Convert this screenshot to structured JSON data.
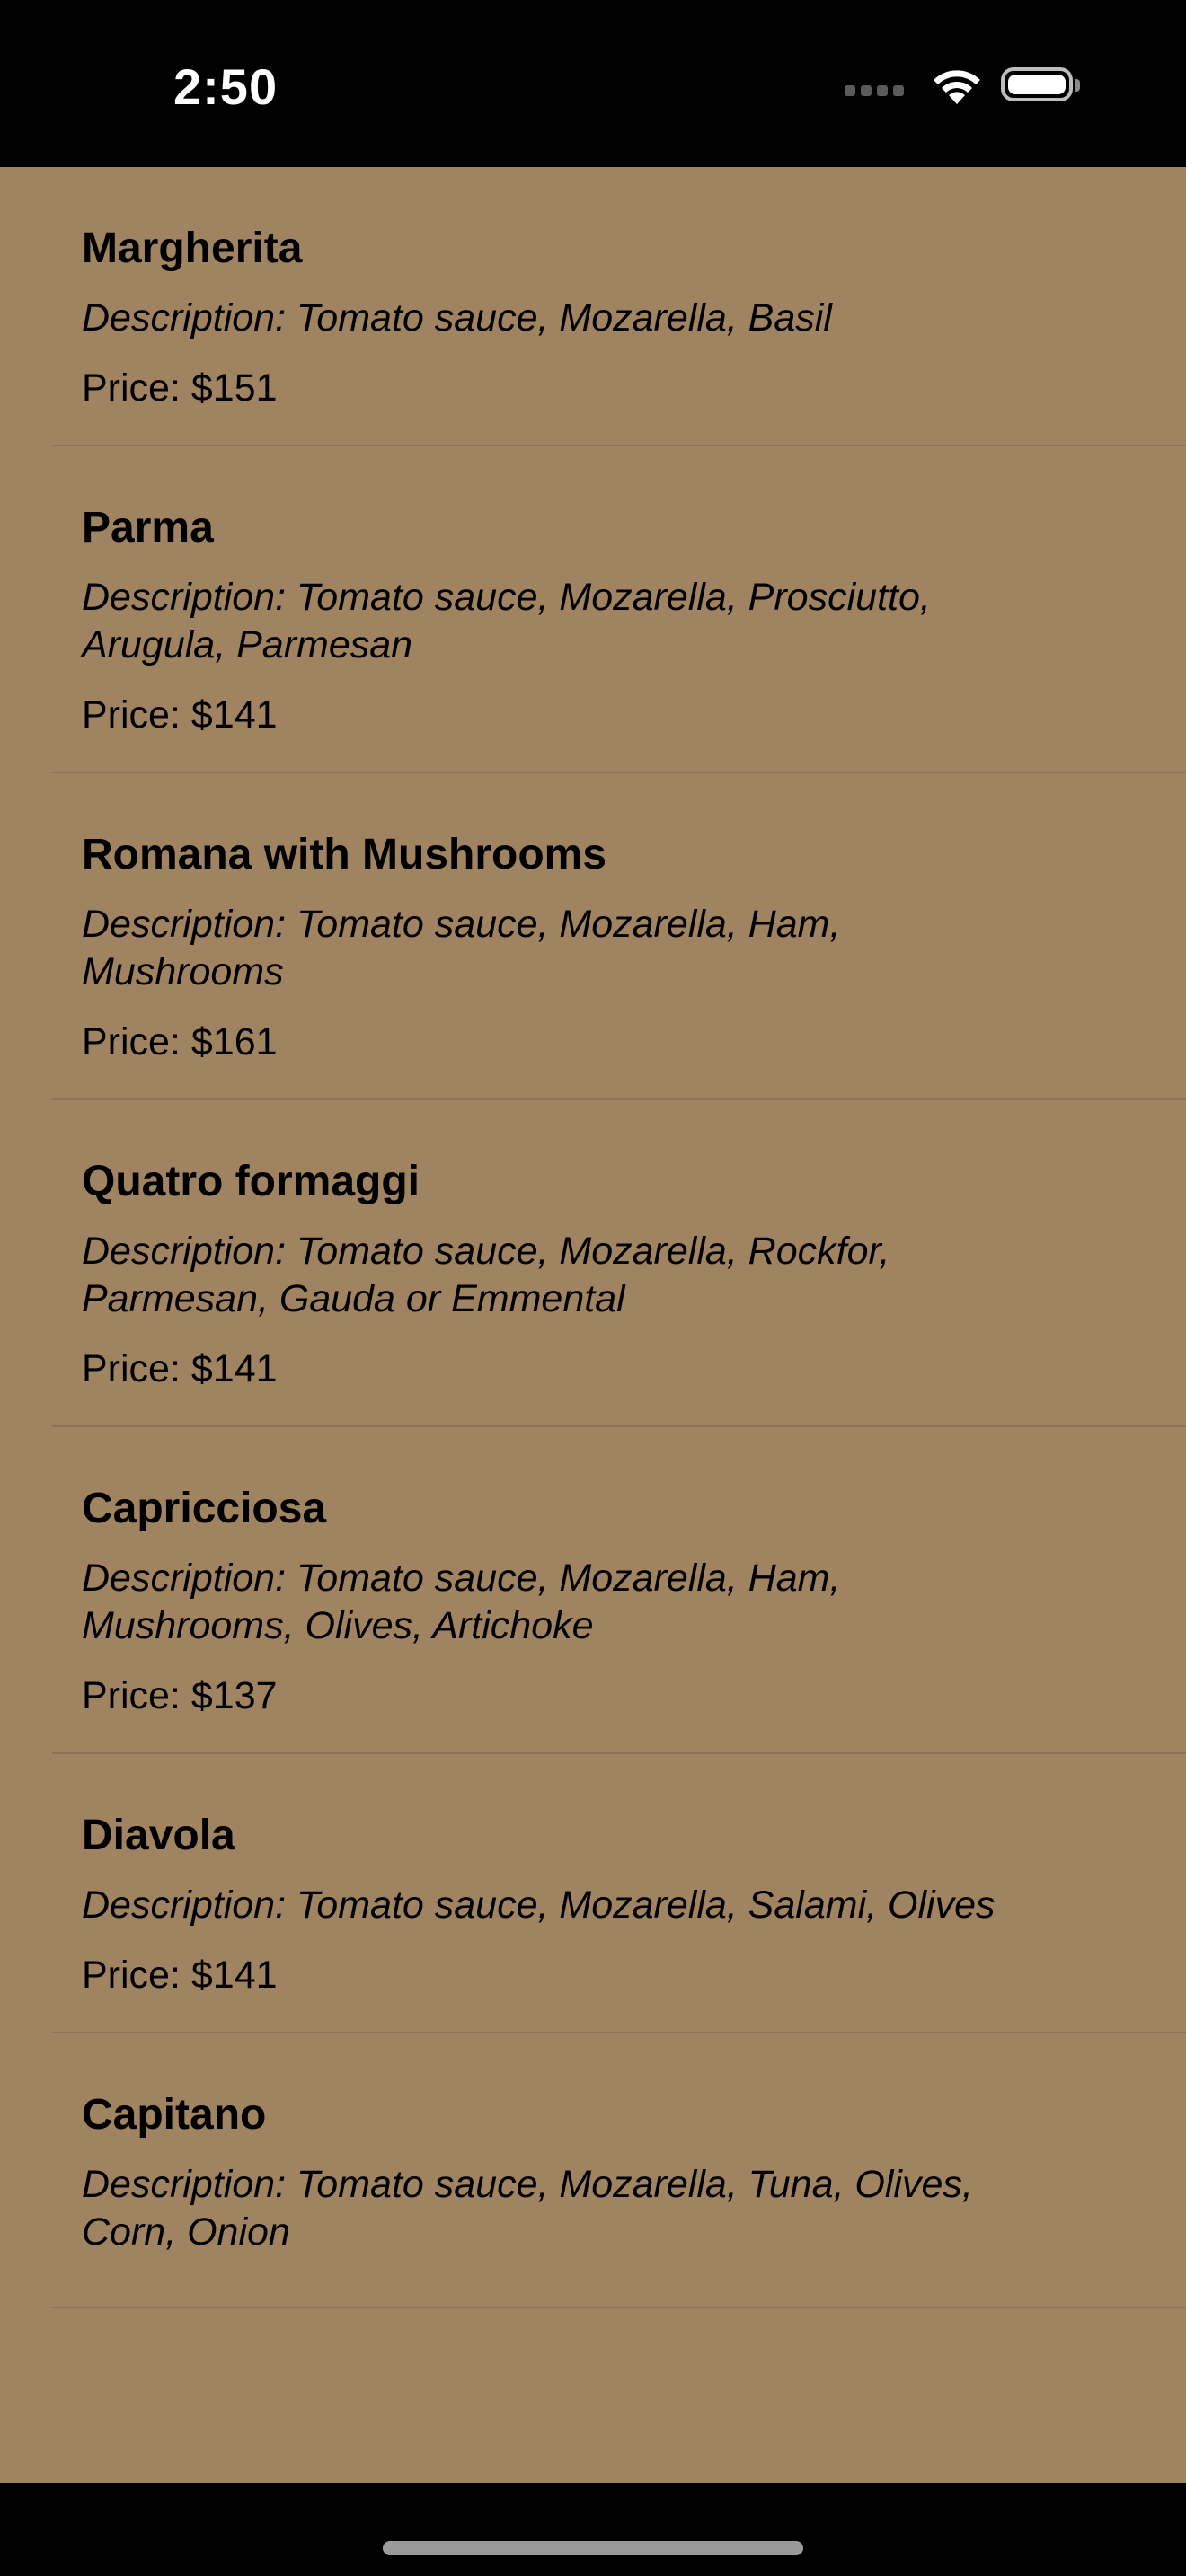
{
  "status_bar": {
    "time": "2:50"
  },
  "menu": {
    "desc_prefix": "Description: ",
    "price_prefix": "Price: ",
    "items": [
      {
        "name": "Margherita",
        "description": "Description: Tomato sauce, Mozarella, Basil",
        "price": "Price: $151"
      },
      {
        "name": "Parma",
        "description": "Description: Tomato sauce, Mozarella, Prosciutto, Arugula, Parmesan",
        "price": "Price: $141"
      },
      {
        "name": "Romana with Mushrooms",
        "description": "Description: Tomato sauce, Mozarella, Ham, Mushrooms",
        "price": "Price: $161"
      },
      {
        "name": "Quatro formaggi",
        "description": "Description: Tomato sauce, Mozarella, Rockfor, Parmesan, Gauda or Emmental",
        "price": "Price: $141"
      },
      {
        "name": "Capricciosa",
        "description": "Description: Tomato sauce, Mozarella, Ham, Mushrooms, Olives, Artichoke",
        "price": "Price: $137"
      },
      {
        "name": "Diavola",
        "description": "Description: Tomato sauce, Mozarella, Salami, Olives",
        "price": "Price: $141"
      },
      {
        "name": "Capitano",
        "description": "Description: Tomato sauce, Mozarella, Tuna, Olives, Corn, Onion",
        "price": ""
      }
    ]
  },
  "colors": {
    "background": "#a08360",
    "bars": "#000000",
    "text": "#000000"
  }
}
